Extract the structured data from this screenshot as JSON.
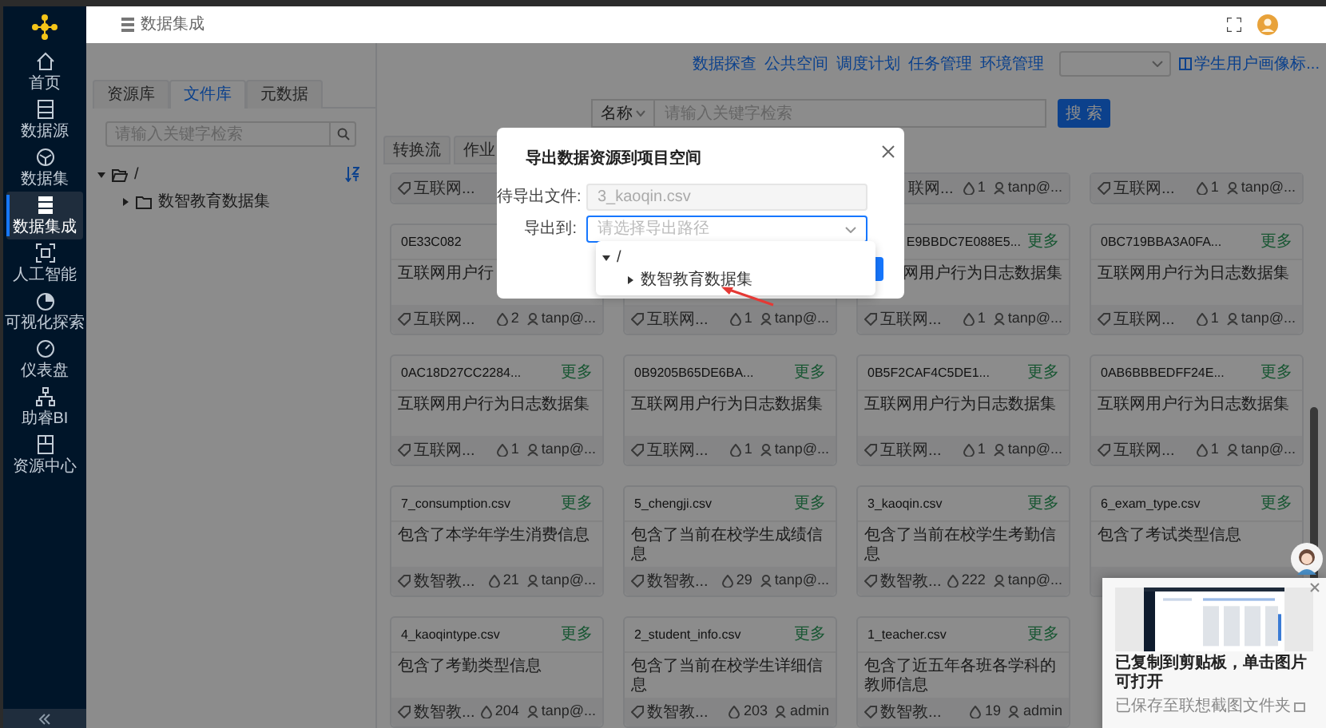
{
  "sidebar": {
    "items": [
      {
        "label": "首页",
        "selected": false
      },
      {
        "label": "数据源",
        "selected": false
      },
      {
        "label": "数据集",
        "selected": false
      },
      {
        "label": "数据集成",
        "selected": true
      },
      {
        "label": "人工智能",
        "selected": false
      },
      {
        "label": "可视化探索",
        "selected": false
      },
      {
        "label": "仪表盘",
        "selected": false
      },
      {
        "label": "助睿BI",
        "selected": false
      },
      {
        "label": "资源中心",
        "selected": false
      }
    ]
  },
  "header": {
    "title": "数据集成"
  },
  "left_panel": {
    "tabs": [
      {
        "label": "资源库",
        "selected": false
      },
      {
        "label": "文件库",
        "selected": true
      },
      {
        "label": "元数据",
        "selected": false
      }
    ],
    "search": {
      "placeholder": "请输入关键字检索"
    },
    "tree": [
      {
        "label": "/",
        "expanded": true,
        "children": [
          {
            "label": "数智教育数据集",
            "expanded": false
          }
        ]
      }
    ]
  },
  "toolbar": {
    "links": [
      "数据探查",
      "公共空间",
      "调度计划",
      "任务管理",
      "环境管理"
    ],
    "project_link": "学生用户画像标..."
  },
  "search": {
    "field": "名称",
    "placeholder": "请输入关键字检索",
    "button": "搜 索"
  },
  "tabs": [
    {
      "label": "转换流"
    },
    {
      "label": "作业"
    }
  ],
  "cards": {
    "rows": [
      {
        "kind": "footer_only",
        "cards": [
          {
            "footer": {
              "tag": "互联网..."
            }
          }
        ],
        "right_cards": [
          {
            "footer": {
              "clipped": true,
              "tag": "联网...",
              "count": "1",
              "user": "tanp@..."
            }
          },
          {
            "footer": {
              "tag": "互联网...",
              "count": "1",
              "user": "tanp@..."
            }
          }
        ]
      },
      {
        "kind": "full",
        "cards": [
          {
            "title": "0E33C082",
            "desc": "互联网用户行",
            "footer": {
              "tag": "互联网...",
              "count": "2",
              "user": "tanp@..."
            }
          },
          {
            "footer": {
              "tag": "互联网...",
              "count": "1",
              "user": "tanp@..."
            }
          },
          {
            "clipped": true,
            "title": "E9BBDC7E088E5...",
            "more": "更多",
            "desc": "网用户行为日志数据集",
            "footer": {
              "tag": "互联网...",
              "count": "1",
              "user": "tanp@..."
            }
          },
          {
            "title": "0BC719BBA3A0FA...",
            "more": "更多",
            "desc": "互联网用户行为日志数据集",
            "footer": {
              "tag": "互联网...",
              "count": "1",
              "user": "tanp@..."
            }
          }
        ]
      },
      {
        "kind": "full",
        "cards": [
          {
            "title": "0AC18D27CC2284...",
            "more": "更多",
            "desc": "互联网用户行为日志数据集",
            "footer": {
              "tag": "互联网...",
              "count": "1",
              "user": "tanp@..."
            }
          },
          {
            "title": "0B9205B65DE6BA...",
            "more": "更多",
            "desc": "互联网用户行为日志数据集",
            "footer": {
              "tag": "互联网...",
              "count": "1",
              "user": "tanp@..."
            }
          },
          {
            "title": "0B5F2CAF4C5DE1...",
            "more": "更多",
            "desc": "互联网用户行为日志数据集",
            "footer": {
              "tag": "互联网...",
              "count": "1",
              "user": "tanp@..."
            }
          },
          {
            "title": "0AB6BBBEDFF24E...",
            "more": "更多",
            "desc": "互联网用户行为日志数据集",
            "footer": {
              "tag": "互联网...",
              "count": "1",
              "user": "tanp@..."
            }
          }
        ]
      },
      {
        "kind": "full",
        "cards": [
          {
            "title": "7_consumption.csv",
            "more": "更多",
            "desc": "包含了本学年学生消费信息",
            "footer": {
              "tag": "数智教...",
              "count": "21",
              "user": "tanp@..."
            }
          },
          {
            "title": "5_chengji.csv",
            "more": "更多",
            "desc": "包含了当前在校学生成绩信息",
            "footer": {
              "tag": "数智教...",
              "count": "29",
              "user": "tanp@..."
            }
          },
          {
            "title": "3_kaoqin.csv",
            "more": "更多",
            "desc": "包含了当前在校学生考勤信息",
            "footer": {
              "tag": "数智教...",
              "count": "222",
              "user": "tanp@..."
            }
          },
          {
            "title": "6_exam_type.csv",
            "more": "更多",
            "desc": "包含了考试类型信息"
          }
        ]
      },
      {
        "kind": "full",
        "cards": [
          {
            "title": "4_kaoqintype.csv",
            "more": "更多",
            "desc": "包含了考勤类型信息",
            "footer": {
              "tag": "数智教...",
              "count": "204",
              "user": "tanp@..."
            }
          },
          {
            "title": "2_student_info.csv",
            "more": "更多",
            "desc": "包含了当前在校学生详细信息",
            "footer": {
              "tag": "数智教...",
              "count": "203",
              "user": "admin"
            }
          },
          {
            "title": "1_teacher.csv",
            "more": "更多",
            "desc": "包含了近五年各班各学科的教师信息",
            "footer": {
              "tag": "数智教...",
              "count": "19",
              "user": "admin"
            }
          }
        ]
      }
    ]
  },
  "dialog": {
    "title": "导出数据资源到项目空间",
    "fields": [
      {
        "kind": "input",
        "label": "待导出文件:",
        "value": "3_kaoqin.csv",
        "disabled": true,
        "open": false
      },
      {
        "kind": "select",
        "label": "导出到:",
        "placeholder": "请选择导出路径",
        "disabled": false,
        "open": true
      }
    ],
    "dropdown_tree": [
      {
        "label": "/",
        "expanded": true,
        "children": [
          {
            "label": "数智教育数据集",
            "expanded": false
          }
        ]
      }
    ]
  },
  "notification": {
    "title": "已复制到剪贴板，单击图片可打开",
    "subtitle": "已保存至联想截图文件夹"
  }
}
